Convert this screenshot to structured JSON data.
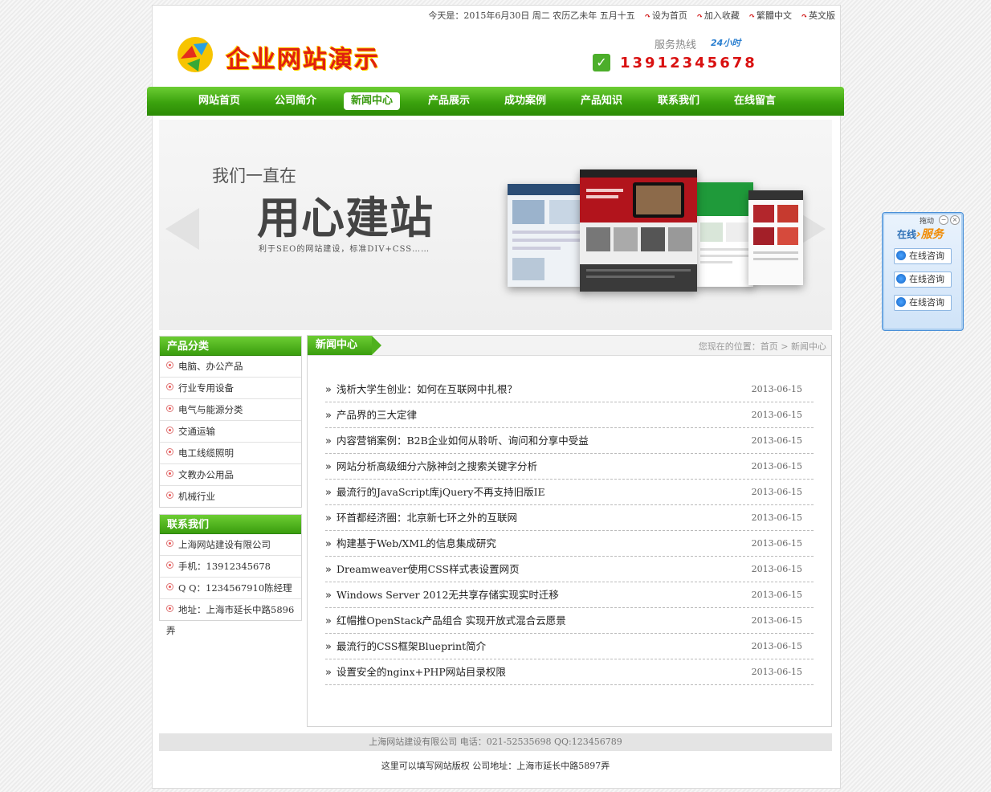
{
  "topbar": {
    "date": "今天是：2015年6月30日 周二 农历乙未年 五月十五",
    "set_home": "设为首页",
    "add_fav": "加入收藏",
    "traditional": "繁體中文",
    "english": "英文版"
  },
  "header": {
    "logo_text": "企业网站演示",
    "hotline_label": "服务热线",
    "badge_24": "24小时",
    "phone": "13912345678"
  },
  "nav": {
    "items": [
      "网站首页",
      "公司简介",
      "新闻中心",
      "产品展示",
      "成功案例",
      "产品知识",
      "联系我们",
      "在线留言"
    ],
    "active_index": 2
  },
  "banner": {
    "line1": "我们一直在",
    "line2": "用心建站",
    "line3": "利于SEO的网站建设，标准DIV+CSS……"
  },
  "sidebar": {
    "products": {
      "title": "产品分类",
      "items": [
        "电脑、办公产品",
        "行业专用设备",
        "电气与能源分类",
        "交通运输",
        "电工线缆照明",
        "文教办公用品",
        "机械行业"
      ]
    },
    "contact": {
      "title": "联系我们",
      "items": [
        "上海网站建设有限公司",
        "手机：13912345678",
        "Q Q：1234567910陈经理",
        "地址：上海市延长中路5896弄"
      ]
    }
  },
  "main": {
    "tab": "新闻中心",
    "breadcrumb": "您现在的位置：首页 > 新闻中心",
    "news": [
      {
        "title": "浅析大学生创业：如何在互联网中扎根？",
        "date": "2013-06-15"
      },
      {
        "title": "产品界的三大定律",
        "date": "2013-06-15"
      },
      {
        "title": "内容营销案例：B2B企业如何从聆听、询问和分享中受益",
        "date": "2013-06-15"
      },
      {
        "title": "网站分析高级细分六脉神剑之搜索关键字分析",
        "date": "2013-06-15"
      },
      {
        "title": "最流行的JavaScript库jQuery不再支持旧版IE",
        "date": "2013-06-15"
      },
      {
        "title": "环首都经济圈：北京新七环之外的互联网",
        "date": "2013-06-15"
      },
      {
        "title": "构建基于Web/XML的信息集成研究",
        "date": "2013-06-15"
      },
      {
        "title": "Dreamweaver使用CSS样式表设置网页",
        "date": "2013-06-15"
      },
      {
        "title": "Windows Server 2012无共享存储实现实时迁移",
        "date": "2013-06-15"
      },
      {
        "title": "红帽推OpenStack产品组合 实现开放式混合云愿景",
        "date": "2013-06-15"
      },
      {
        "title": "最流行的CSS框架Blueprint简介",
        "date": "2013-06-15"
      },
      {
        "title": "设置安全的nginx+PHP网站目录权限",
        "date": "2013-06-15"
      }
    ]
  },
  "footer": {
    "line1": "上海网站建设有限公司 电话：021-52535698 QQ:123456789",
    "line2": "这里可以填写网站版权 公司地址：上海市延长中路5897弄"
  },
  "service": {
    "drag": "拖动",
    "title_a": "在线",
    "title_b": "服务",
    "items": [
      "在线咨询",
      "在线咨询",
      "在线咨询"
    ]
  },
  "colors": {
    "nav_green": "#3ba20e",
    "phone_red": "#d91010",
    "logo_red": "#e02010",
    "service_blue": "#4a90d8"
  }
}
